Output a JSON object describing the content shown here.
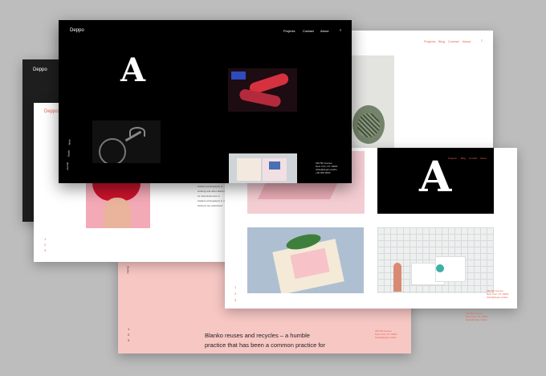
{
  "brand": "Deppo",
  "nav": [
    "Projects",
    "Contact",
    "About"
  ],
  "nav_full": [
    "Projects",
    "Blog",
    "Contact",
    "About"
  ],
  "menu_glyph": "≡",
  "logo_letter": "A",
  "side_menu": [
    "Work",
    "Studio",
    "Journal"
  ],
  "address_lines": [
    "236 5th Avenue",
    "New York, NY 10001",
    "hello@deppo.studio",
    "+00 000 0000"
  ],
  "fashion_lines": [
    "Fashion photography is",
    "clothing and other fashion",
    "for advertisements or",
    "Fashion photography is most",
    "fashions are advertised"
  ],
  "pager": [
    "1",
    "2",
    "3"
  ],
  "pink_heading_line1": "Blanko reuses and recycles – a humble",
  "pink_heading_line2": "practice that has been a common practice for",
  "pink_side": "Blanko",
  "colors": {
    "background": "#bdbdbd",
    "accent": "#e8604c",
    "black": "#000000",
    "pink": "#f7c7c4",
    "white": "#ffffff"
  }
}
